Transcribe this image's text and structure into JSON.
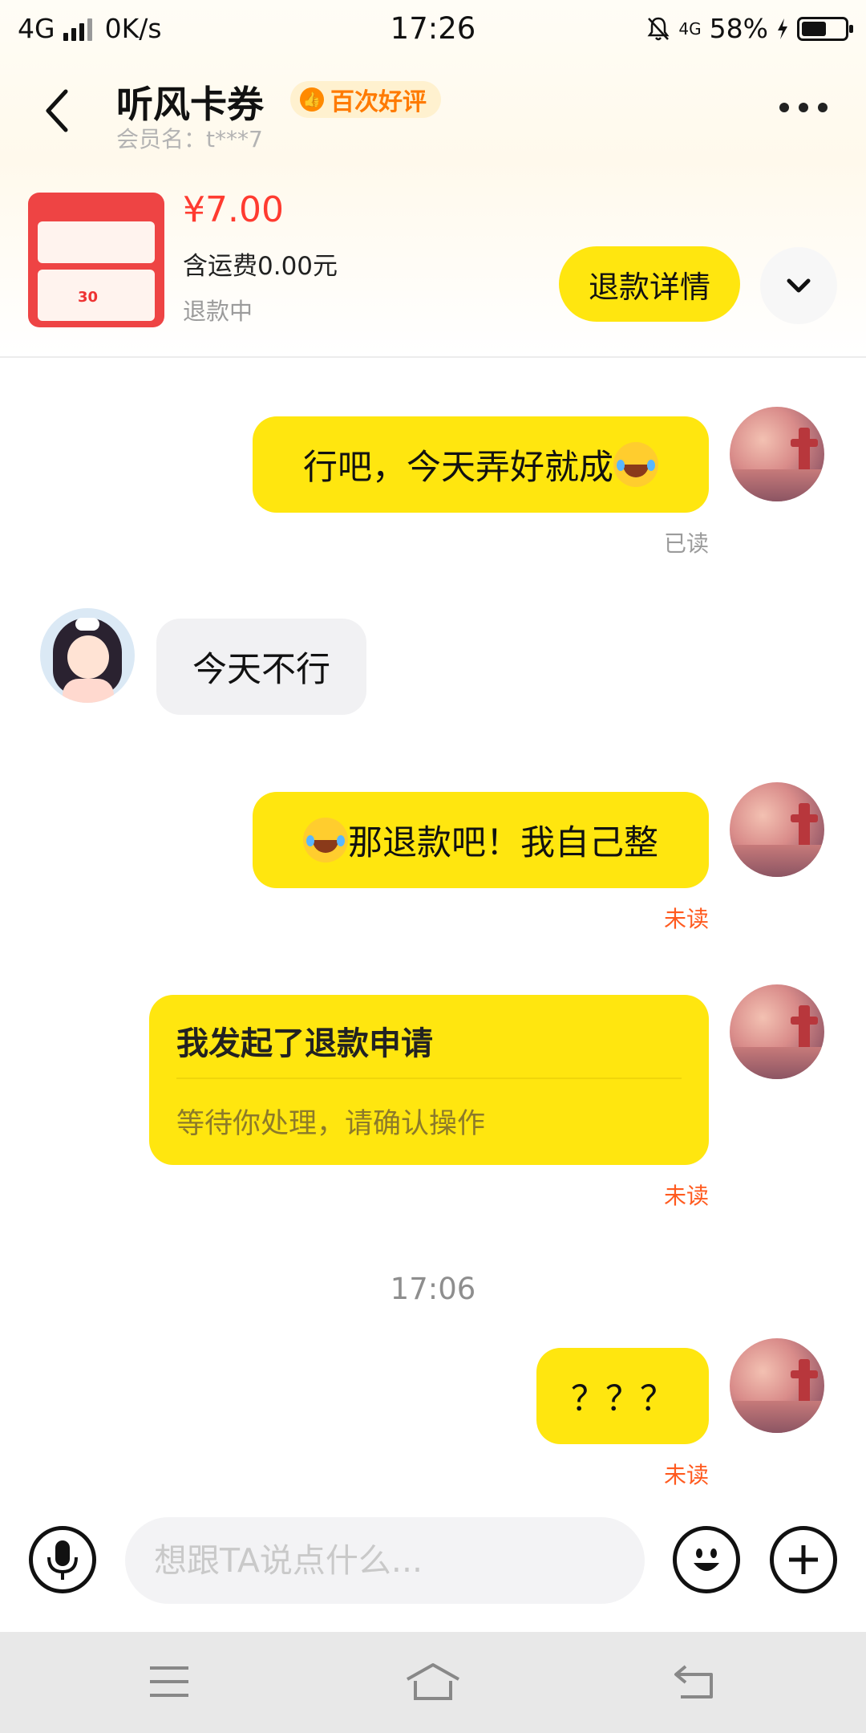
{
  "status_bar": {
    "network": "4G",
    "speed": "0K/s",
    "time": "17:26",
    "network2": "4G",
    "battery": "58%"
  },
  "header": {
    "shop_name": "听风卡券",
    "badge": "百次好评",
    "member": "会员名：t***7"
  },
  "order": {
    "price": "¥7.00",
    "shipping": "含运费0.00元",
    "status": "退款中",
    "refund_button": "退款详情",
    "thumb_number": "30"
  },
  "messages": {
    "m1": {
      "text": "行吧，今天弄好就成",
      "status": "已读"
    },
    "m2": {
      "text": "今天不行"
    },
    "m3": {
      "text": "那退款吧！我自己整",
      "status": "未读"
    },
    "m4": {
      "title": "我发起了退款申请",
      "subtitle": "等待你处理，请确认操作",
      "status": "未读"
    },
    "time_separator": "17:06",
    "m5": {
      "text": "？？？",
      "status": "未读"
    }
  },
  "input": {
    "placeholder": "想跟TA说点什么..."
  },
  "colors": {
    "accent_yellow": "#ffe60f",
    "price_red": "#ff3b30",
    "unread_orange": "#ff5a1f"
  },
  "icons": [
    "back-icon",
    "thumbs-up-icon",
    "more-icon",
    "chevron-down-icon",
    "microphone-icon",
    "emoji-icon",
    "plus-icon",
    "menu-icon",
    "home-icon",
    "back-nav-icon"
  ]
}
